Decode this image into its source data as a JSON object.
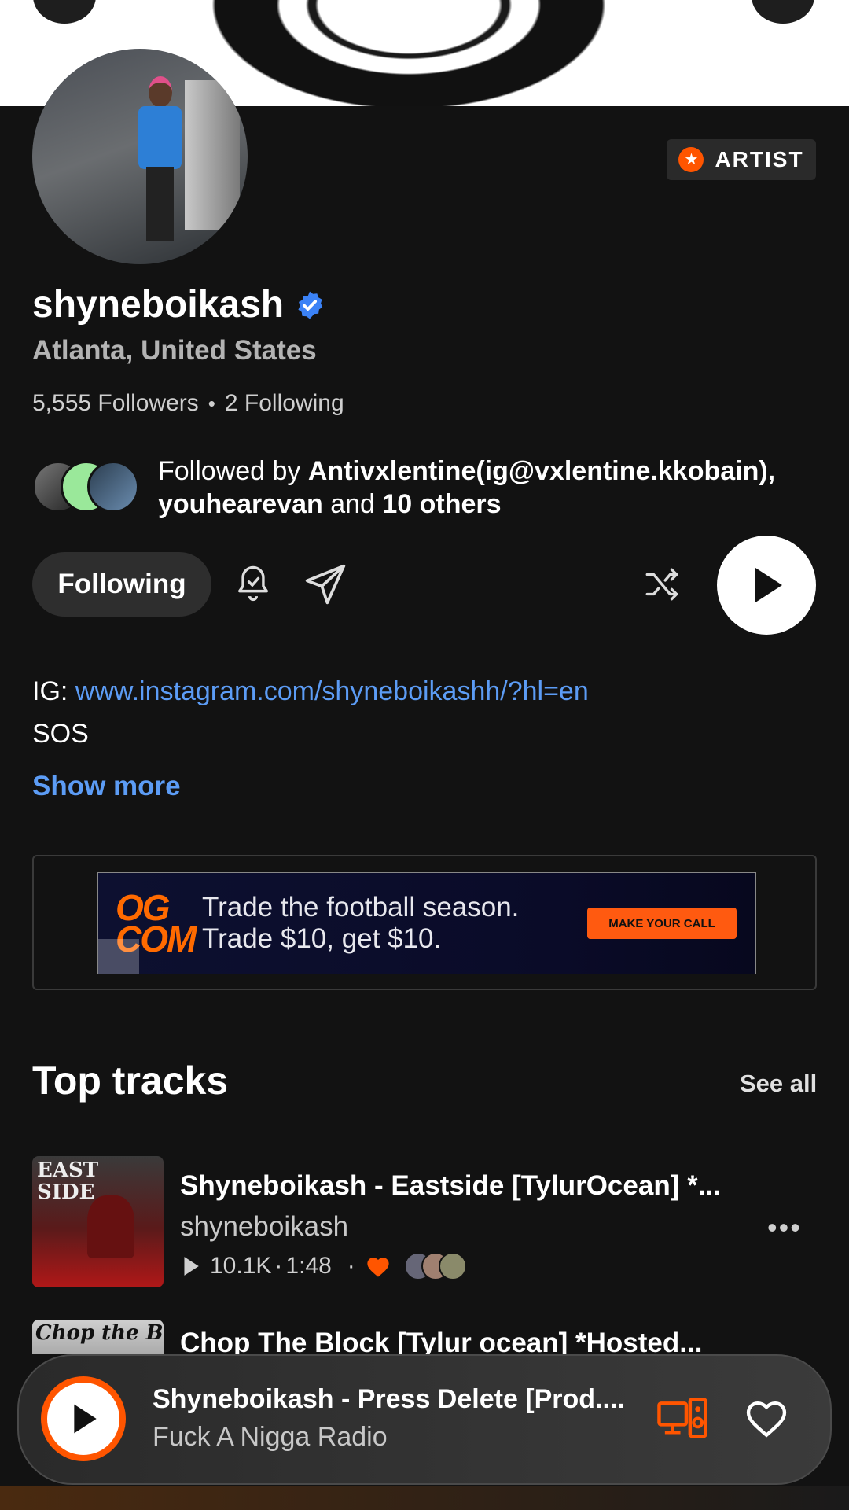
{
  "header": {
    "back_icon": "chevron-left-icon",
    "menu_icon": "more-icon"
  },
  "profile": {
    "badge_label": "ARTIST",
    "name": "shyneboikash",
    "location": "Atlanta, United States",
    "followers": "5,555 Followers",
    "separator": "•",
    "following": "2 Following"
  },
  "followed_by": {
    "prefix": "Followed by ",
    "user1": "Antivxlentine(ig@vxlentine.kkobain),",
    "user2": "youhearevan",
    "and": " and ",
    "others": "10 others"
  },
  "actions": {
    "following_label": "Following"
  },
  "bio": {
    "ig_prefix": "IG: ",
    "ig_link": "www.instagram.com/shyneboikashh/?hl=en",
    "line2": "SOS",
    "show_more": "Show more"
  },
  "ad": {
    "logo": "OG COM",
    "line1": "Trade the football season.",
    "line2": "Trade $10, get $10.",
    "cta": "MAKE YOUR CALL"
  },
  "top_tracks": {
    "title": "Top tracks",
    "see_all": "See all",
    "items": [
      {
        "title": "Shyneboikash - Eastside [TylurOcean] *...",
        "artist": "shyneboikash",
        "plays": "10.1K",
        "duration": "1:48",
        "art_text": "EAST SIDE"
      },
      {
        "title": "Chop The Block [Tylur ocean] *Hosted...",
        "art_text": "Chop the Block"
      }
    ]
  },
  "mini_player": {
    "title": "Shyneboikash - Press Delete [Prod....",
    "subtitle": "Fuck A Nigga Radio"
  },
  "colors": {
    "accent": "#ff5500",
    "link": "#5c9cf5",
    "background": "#121212"
  }
}
